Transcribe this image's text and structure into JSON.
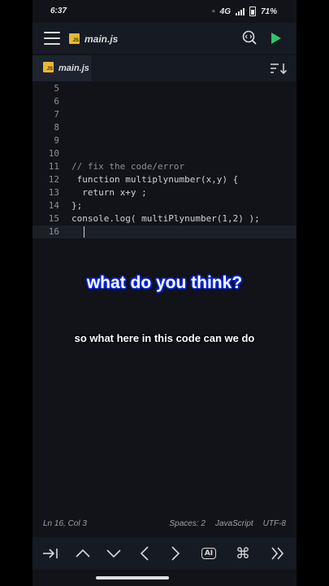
{
  "status_bar": {
    "time": "6:37",
    "network": "4G",
    "battery": "71%"
  },
  "toolbar": {
    "file_title": "main.js",
    "badge": "JS"
  },
  "tab": {
    "label": "main.js",
    "badge": "JS"
  },
  "editor": {
    "lines": [
      {
        "n": "5",
        "code": ""
      },
      {
        "n": "6",
        "code": ""
      },
      {
        "n": "7",
        "code": ""
      },
      {
        "n": "8",
        "code": ""
      },
      {
        "n": "9",
        "code": ""
      },
      {
        "n": "10",
        "code": ""
      },
      {
        "n": "11",
        "code": "// fix the code/error"
      },
      {
        "n": "12",
        "code": " function multiplynumber(x,y) {"
      },
      {
        "n": "13",
        "code": "  return x+y ;"
      },
      {
        "n": "14",
        "code": "};"
      },
      {
        "n": "15",
        "code": "console.log( multiPlynumber(1,2) );"
      },
      {
        "n": "16",
        "code": ""
      }
    ]
  },
  "captions": {
    "main": "what do you think?",
    "sub": "so what here in this code can we do"
  },
  "status_line": {
    "position": "Ln 16, Col 3",
    "spaces": "Spaces: 2",
    "language": "JavaScript",
    "encoding": "UTF-8"
  },
  "keys": {
    "ai_label": "AI"
  },
  "colors": {
    "accent": "#2fc46b",
    "js_badge": "#e8b931",
    "caption_glow": "#0a2cff"
  }
}
